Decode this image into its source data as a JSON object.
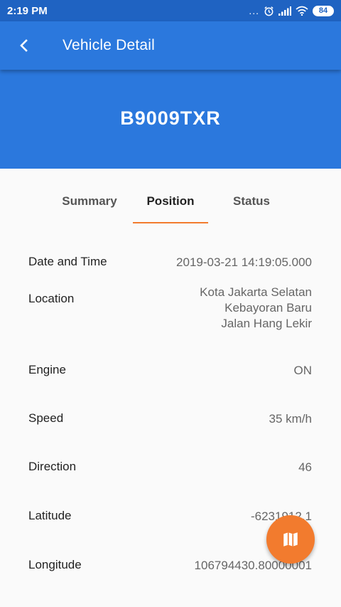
{
  "status_bar": {
    "time": "2:19 PM",
    "dots": "...",
    "battery": "84"
  },
  "app_bar": {
    "title": "Vehicle Detail",
    "back_icon": "chevron-left-icon"
  },
  "vehicle": {
    "plate": "B9009TXR"
  },
  "tabs": [
    {
      "label": "Summary",
      "active": false
    },
    {
      "label": "Position",
      "active": true
    },
    {
      "label": "Status",
      "active": false
    }
  ],
  "details": {
    "date_time": {
      "label": "Date and Time",
      "value": "2019-03-21 14:19:05.000"
    },
    "location": {
      "label": "Location",
      "lines": [
        "Kota Jakarta Selatan",
        "Kebayoran Baru",
        "Jalan Hang Lekir"
      ]
    },
    "engine": {
      "label": "Engine",
      "value": "ON"
    },
    "speed": {
      "label": "Speed",
      "value": "35 km/h"
    },
    "direction": {
      "label": "Direction",
      "value": "46"
    },
    "latitude": {
      "label": "Latitude",
      "value": "-6231912.1"
    },
    "longitude": {
      "label": "Longitude",
      "value": "106794430.80000001"
    }
  },
  "fab": {
    "icon": "map-icon"
  },
  "colors": {
    "primary": "#2b78dd",
    "status_bar": "#1f63c2",
    "accent": "#f27b2e"
  }
}
